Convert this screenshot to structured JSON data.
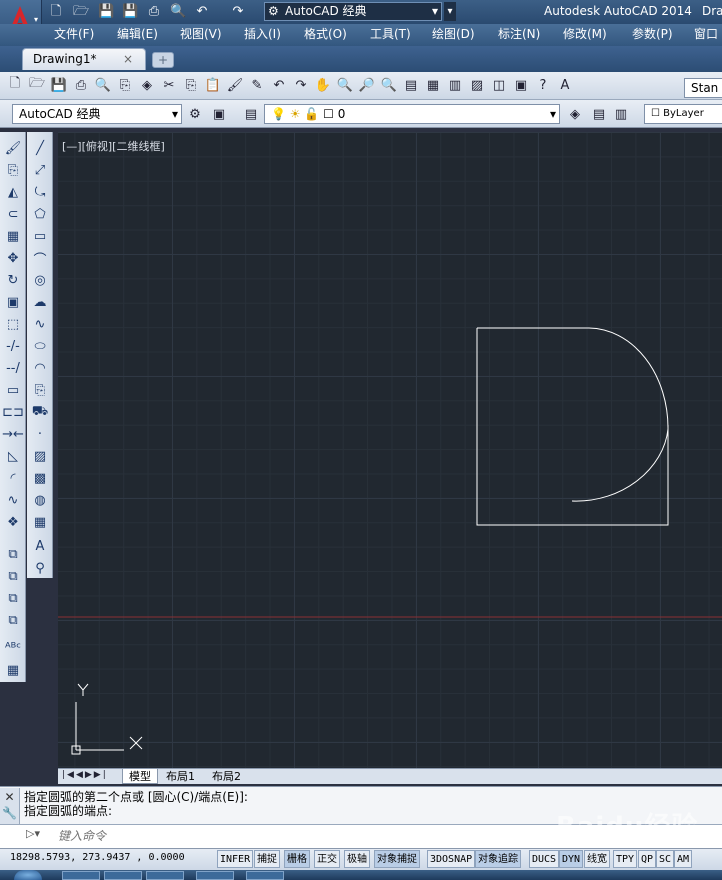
{
  "window": {
    "title": "Autodesk AutoCAD 2014",
    "title_suffix": "Dra",
    "workspace": "AutoCAD 经典"
  },
  "menu": [
    "文件(F)",
    "编辑(E)",
    "视图(V)",
    "插入(I)",
    "格式(O)",
    "工具(T)",
    "绘图(D)",
    "标注(N)",
    "修改(M)",
    "参数(P)",
    "窗口"
  ],
  "document_tab": {
    "label": "Drawing1*",
    "close": "×"
  },
  "toolbar2": {
    "workspace_combo": "AutoCAD 经典",
    "layer_combo": "0",
    "style_combo": "Stan",
    "bylayer": "ByLayer"
  },
  "viewport": {
    "label": "[—][俯视][二维线框]"
  },
  "ucs": {
    "x": "X",
    "y": "Y"
  },
  "layout_tabs": [
    "模型",
    "布局1",
    "布局2"
  ],
  "command": {
    "history": [
      "指定圆弧的第二个点或 [圆心(C)/端点(E)]:",
      "指定圆弧的端点:"
    ],
    "placeholder": "键入命令"
  },
  "status": {
    "coords": "18298.5793, 273.9437 , 0.0000",
    "buttons": [
      "INFER",
      "捕捉",
      "栅格",
      "正交",
      "极轴",
      "对象捕捉",
      "3DOSNAP",
      "对象追踪",
      "DUCS",
      "DYN",
      "线宽",
      "TPY",
      "QP",
      "SC",
      "AM"
    ]
  },
  "watermark": "Baidu经验",
  "colors": {
    "canvas": "#212830",
    "geometry": "#ffffff",
    "axis": "#8a2f35"
  }
}
